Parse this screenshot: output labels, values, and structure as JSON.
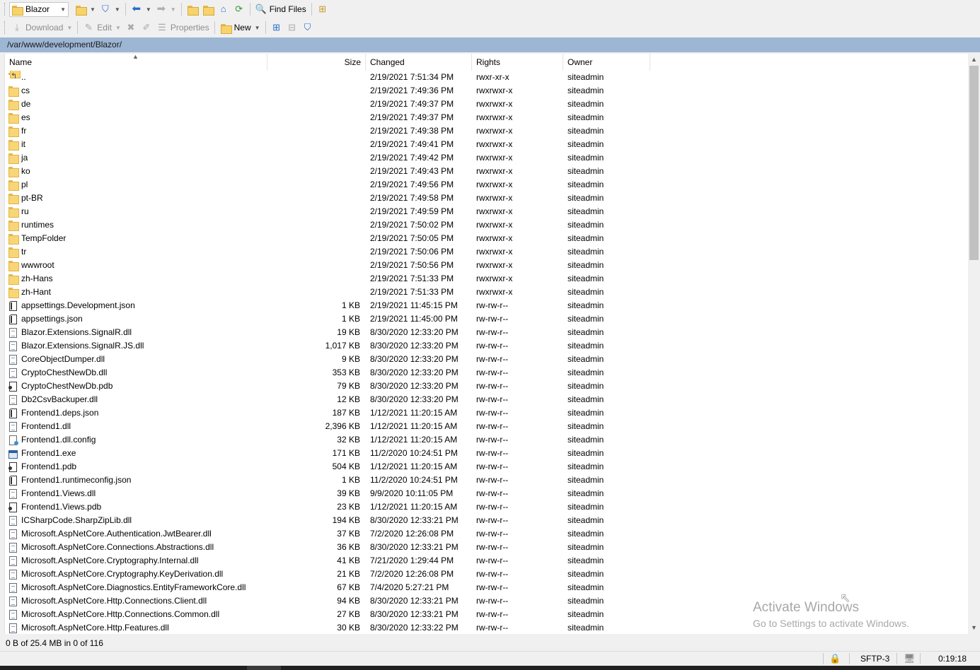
{
  "toolbar1": {
    "location_combo": "Blazor",
    "find_files": "Find Files"
  },
  "toolbar2": {
    "download": "Download",
    "edit": "Edit",
    "properties": "Properties",
    "new": "New"
  },
  "path": "/var/www/development/Blazor/",
  "columns": {
    "name": "Name",
    "size": "Size",
    "changed": "Changed",
    "rights": "Rights",
    "owner": "Owner"
  },
  "files": [
    {
      "name": "..",
      "size": "",
      "changed": "2/19/2021 7:51:34 PM",
      "rights": "rwxr-xr-x",
      "owner": "siteadmin",
      "icon": "parent-folder-icon"
    },
    {
      "name": "cs",
      "size": "",
      "changed": "2/19/2021 7:49:36 PM",
      "rights": "rwxrwxr-x",
      "owner": "siteadmin",
      "icon": "folder-icon"
    },
    {
      "name": "de",
      "size": "",
      "changed": "2/19/2021 7:49:37 PM",
      "rights": "rwxrwxr-x",
      "owner": "siteadmin",
      "icon": "folder-icon"
    },
    {
      "name": "es",
      "size": "",
      "changed": "2/19/2021 7:49:37 PM",
      "rights": "rwxrwxr-x",
      "owner": "siteadmin",
      "icon": "folder-icon"
    },
    {
      "name": "fr",
      "size": "",
      "changed": "2/19/2021 7:49:38 PM",
      "rights": "rwxrwxr-x",
      "owner": "siteadmin",
      "icon": "folder-icon"
    },
    {
      "name": "it",
      "size": "",
      "changed": "2/19/2021 7:49:41 PM",
      "rights": "rwxrwxr-x",
      "owner": "siteadmin",
      "icon": "folder-icon"
    },
    {
      "name": "ja",
      "size": "",
      "changed": "2/19/2021 7:49:42 PM",
      "rights": "rwxrwxr-x",
      "owner": "siteadmin",
      "icon": "folder-icon"
    },
    {
      "name": "ko",
      "size": "",
      "changed": "2/19/2021 7:49:43 PM",
      "rights": "rwxrwxr-x",
      "owner": "siteadmin",
      "icon": "folder-icon"
    },
    {
      "name": "pl",
      "size": "",
      "changed": "2/19/2021 7:49:56 PM",
      "rights": "rwxrwxr-x",
      "owner": "siteadmin",
      "icon": "folder-icon"
    },
    {
      "name": "pt-BR",
      "size": "",
      "changed": "2/19/2021 7:49:58 PM",
      "rights": "rwxrwxr-x",
      "owner": "siteadmin",
      "icon": "folder-icon"
    },
    {
      "name": "ru",
      "size": "",
      "changed": "2/19/2021 7:49:59 PM",
      "rights": "rwxrwxr-x",
      "owner": "siteadmin",
      "icon": "folder-icon"
    },
    {
      "name": "runtimes",
      "size": "",
      "changed": "2/19/2021 7:50:02 PM",
      "rights": "rwxrwxr-x",
      "owner": "siteadmin",
      "icon": "folder-icon"
    },
    {
      "name": "TempFolder",
      "size": "",
      "changed": "2/19/2021 7:50:05 PM",
      "rights": "rwxrwxr-x",
      "owner": "siteadmin",
      "icon": "folder-icon"
    },
    {
      "name": "tr",
      "size": "",
      "changed": "2/19/2021 7:50:06 PM",
      "rights": "rwxrwxr-x",
      "owner": "siteadmin",
      "icon": "folder-icon"
    },
    {
      "name": "wwwroot",
      "size": "",
      "changed": "2/19/2021 7:50:56 PM",
      "rights": "rwxrwxr-x",
      "owner": "siteadmin",
      "icon": "folder-icon"
    },
    {
      "name": "zh-Hans",
      "size": "",
      "changed": "2/19/2021 7:51:33 PM",
      "rights": "rwxrwxr-x",
      "owner": "siteadmin",
      "icon": "folder-icon"
    },
    {
      "name": "zh-Hant",
      "size": "",
      "changed": "2/19/2021 7:51:33 PM",
      "rights": "rwxrwxr-x",
      "owner": "siteadmin",
      "icon": "folder-icon"
    },
    {
      "name": "appsettings.Development.json",
      "size": "1 KB",
      "changed": "2/19/2021 11:45:15 PM",
      "rights": "rw-rw-r--",
      "owner": "siteadmin",
      "icon": "json-file-icon"
    },
    {
      "name": "appsettings.json",
      "size": "1 KB",
      "changed": "2/19/2021 11:45:00 PM",
      "rights": "rw-rw-r--",
      "owner": "siteadmin",
      "icon": "json-file-icon"
    },
    {
      "name": "Blazor.Extensions.SignalR.dll",
      "size": "19 KB",
      "changed": "8/30/2020 12:33:20 PM",
      "rights": "rw-rw-r--",
      "owner": "siteadmin",
      "icon": "dll-file-icon"
    },
    {
      "name": "Blazor.Extensions.SignalR.JS.dll",
      "size": "1,017 KB",
      "changed": "8/30/2020 12:33:20 PM",
      "rights": "rw-rw-r--",
      "owner": "siteadmin",
      "icon": "dll-file-icon"
    },
    {
      "name": "CoreObjectDumper.dll",
      "size": "9 KB",
      "changed": "8/30/2020 12:33:20 PM",
      "rights": "rw-rw-r--",
      "owner": "siteadmin",
      "icon": "dll-file-icon"
    },
    {
      "name": "CryptoChestNewDb.dll",
      "size": "353 KB",
      "changed": "8/30/2020 12:33:20 PM",
      "rights": "rw-rw-r--",
      "owner": "siteadmin",
      "icon": "dll-file-icon"
    },
    {
      "name": "CryptoChestNewDb.pdb",
      "size": "79 KB",
      "changed": "8/30/2020 12:33:20 PM",
      "rights": "rw-rw-r--",
      "owner": "siteadmin",
      "icon": "pdb-file-icon"
    },
    {
      "name": "Db2CsvBackuper.dll",
      "size": "12 KB",
      "changed": "8/30/2020 12:33:20 PM",
      "rights": "rw-rw-r--",
      "owner": "siteadmin",
      "icon": "dll-file-icon"
    },
    {
      "name": "Frontend1.deps.json",
      "size": "187 KB",
      "changed": "1/12/2021 11:20:15 AM",
      "rights": "rw-rw-r--",
      "owner": "siteadmin",
      "icon": "json-file-icon"
    },
    {
      "name": "Frontend1.dll",
      "size": "2,396 KB",
      "changed": "1/12/2021 11:20:15 AM",
      "rights": "rw-rw-r--",
      "owner": "siteadmin",
      "icon": "dll-file-icon"
    },
    {
      "name": "Frontend1.dll.config",
      "size": "32 KB",
      "changed": "1/12/2021 11:20:15 AM",
      "rights": "rw-rw-r--",
      "owner": "siteadmin",
      "icon": "config-file-icon"
    },
    {
      "name": "Frontend1.exe",
      "size": "171 KB",
      "changed": "11/2/2020 10:24:51 PM",
      "rights": "rw-rw-r--",
      "owner": "siteadmin",
      "icon": "exe-file-icon"
    },
    {
      "name": "Frontend1.pdb",
      "size": "504 KB",
      "changed": "1/12/2021 11:20:15 AM",
      "rights": "rw-rw-r--",
      "owner": "siteadmin",
      "icon": "pdb-file-icon"
    },
    {
      "name": "Frontend1.runtimeconfig.json",
      "size": "1 KB",
      "changed": "11/2/2020 10:24:51 PM",
      "rights": "rw-rw-r--",
      "owner": "siteadmin",
      "icon": "json-file-icon"
    },
    {
      "name": "Frontend1.Views.dll",
      "size": "39 KB",
      "changed": "9/9/2020 10:11:05 PM",
      "rights": "rw-rw-r--",
      "owner": "siteadmin",
      "icon": "dll-file-icon"
    },
    {
      "name": "Frontend1.Views.pdb",
      "size": "23 KB",
      "changed": "1/12/2021 11:20:15 AM",
      "rights": "rw-rw-r--",
      "owner": "siteadmin",
      "icon": "pdb-file-icon"
    },
    {
      "name": "ICSharpCode.SharpZipLib.dll",
      "size": "194 KB",
      "changed": "8/30/2020 12:33:21 PM",
      "rights": "rw-rw-r--",
      "owner": "siteadmin",
      "icon": "dll-file-icon"
    },
    {
      "name": "Microsoft.AspNetCore.Authentication.JwtBearer.dll",
      "size": "37 KB",
      "changed": "7/2/2020 12:26:08 PM",
      "rights": "rw-rw-r--",
      "owner": "siteadmin",
      "icon": "dll-file-icon"
    },
    {
      "name": "Microsoft.AspNetCore.Connections.Abstractions.dll",
      "size": "36 KB",
      "changed": "8/30/2020 12:33:21 PM",
      "rights": "rw-rw-r--",
      "owner": "siteadmin",
      "icon": "dll-file-icon"
    },
    {
      "name": "Microsoft.AspNetCore.Cryptography.Internal.dll",
      "size": "41 KB",
      "changed": "7/21/2020 1:29:44 PM",
      "rights": "rw-rw-r--",
      "owner": "siteadmin",
      "icon": "dll-file-icon"
    },
    {
      "name": "Microsoft.AspNetCore.Cryptography.KeyDerivation.dll",
      "size": "21 KB",
      "changed": "7/2/2020 12:26:08 PM",
      "rights": "rw-rw-r--",
      "owner": "siteadmin",
      "icon": "dll-file-icon"
    },
    {
      "name": "Microsoft.AspNetCore.Diagnostics.EntityFrameworkCore.dll",
      "size": "67 KB",
      "changed": "7/4/2020 5:27:21 PM",
      "rights": "rw-rw-r--",
      "owner": "siteadmin",
      "icon": "dll-file-icon"
    },
    {
      "name": "Microsoft.AspNetCore.Http.Connections.Client.dll",
      "size": "94 KB",
      "changed": "8/30/2020 12:33:21 PM",
      "rights": "rw-rw-r--",
      "owner": "siteadmin",
      "icon": "dll-file-icon"
    },
    {
      "name": "Microsoft.AspNetCore.Http.Connections.Common.dll",
      "size": "27 KB",
      "changed": "8/30/2020 12:33:21 PM",
      "rights": "rw-rw-r--",
      "owner": "siteadmin",
      "icon": "dll-file-icon"
    },
    {
      "name": "Microsoft.AspNetCore.Http.Features.dll",
      "size": "30 KB",
      "changed": "8/30/2020 12:33:22 PM",
      "rights": "rw-rw-r--",
      "owner": "siteadmin",
      "icon": "dll-file-icon"
    }
  ],
  "watermark": {
    "title": "Activate Windows",
    "subtitle": "Go to Settings to activate Windows."
  },
  "status": {
    "selection": "0 B of 25.4 MB in 0 of 116",
    "protocol": "SFTP-3",
    "elapsed": "0:19:18"
  },
  "colors": {
    "path_bar": "#9db6d3",
    "folder": "#f9d675"
  }
}
